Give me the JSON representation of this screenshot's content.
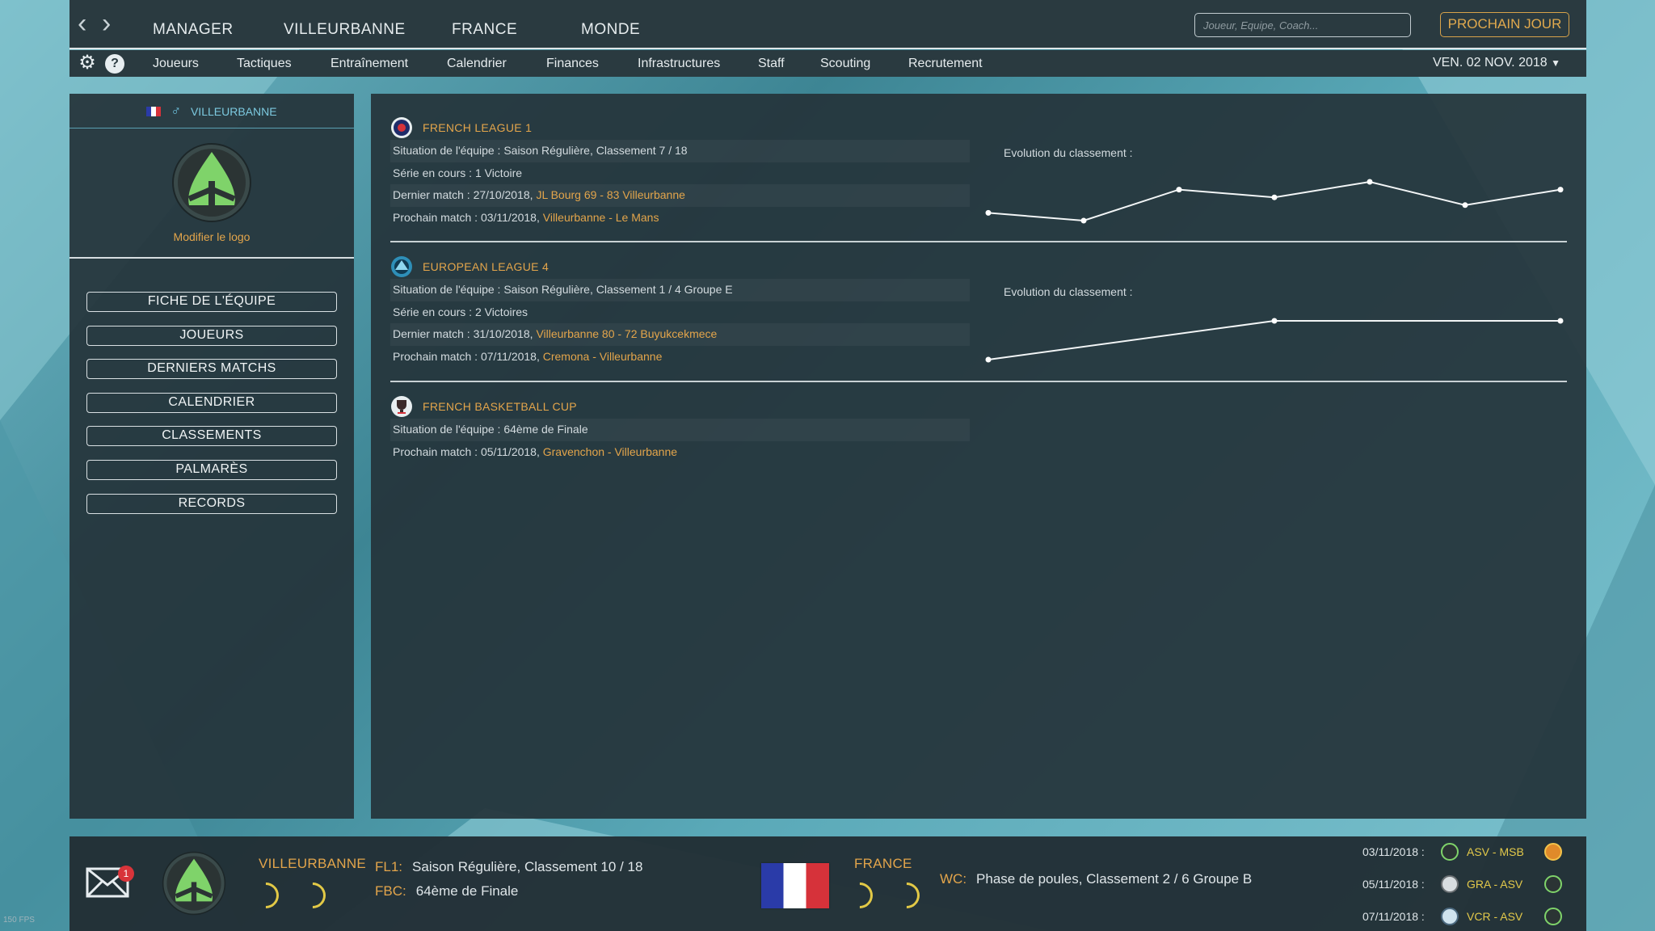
{
  "nav": {
    "main": [
      "MANAGER",
      "VILLEURBANNE",
      "FRANCE",
      "MONDE"
    ],
    "sub": [
      "Joueurs",
      "Tactiques",
      "Entraînement",
      "Calendrier",
      "Finances",
      "Infrastructures",
      "Staff",
      "Scouting",
      "Recrutement"
    ],
    "search_placeholder": "Joueur, Equipe, Coach...",
    "next_day_label": "PROCHAIN JOUR",
    "date": "VEN. 02 NOV. 2018"
  },
  "team": {
    "name": "VILLEURBANNE",
    "modify_logo": "Modifier le logo",
    "menu": [
      "FICHE DE L'ÉQUIPE",
      "JOUEURS",
      "DERNIERS MATCHS",
      "CALENDRIER",
      "CLASSEMENTS",
      "PALMARÈS",
      "RECORDS"
    ]
  },
  "competitions": [
    {
      "name": "FRENCH LEAGUE 1",
      "situation": "Situation de l'équipe : Saison Régulière, Classement 7 / 18",
      "serie": "Série en cours : 1 Victoire",
      "last_prefix": "Dernier match : 27/10/2018, ",
      "last_link": "JL Bourg 69 - 83 Villeurbanne",
      "next_prefix": "Prochain match : 03/11/2018, ",
      "next_link": "Villeurbanne - Le Mans",
      "evo_label": "Evolution du classement :",
      "evolution": [
        10,
        11,
        7,
        8,
        6,
        9,
        7
      ]
    },
    {
      "name": "EUROPEAN LEAGUE 4",
      "situation": "Situation de l'équipe : Saison Régulière, Classement 1 / 4 Groupe E",
      "serie": "Série en cours : 2 Victoires",
      "last_prefix": "Dernier match : 31/10/2018, ",
      "last_link": "Villeurbanne 80 - 72 Buyukcekmece",
      "next_prefix": "Prochain match : 07/11/2018, ",
      "next_link": "Cremona - Villeurbanne",
      "evo_label": "Evolution du classement :",
      "evolution": [
        2,
        1,
        1
      ]
    },
    {
      "name": "FRENCH BASKETBALL CUP",
      "situation": "Situation de l'équipe : 64ème de Finale",
      "next_prefix": "Prochain match : 05/11/2018, ",
      "next_link": "Gravenchon - Villeurbanne"
    }
  ],
  "bottom": {
    "mail_count": "1",
    "team_name": "VILLEURBANNE",
    "fl1_key": "FL1:",
    "fl1_value": "Saison Régulière, Classement 10 / 18",
    "fbc_key": "FBC:",
    "fbc_value": "64ème de Finale",
    "country": "FRANCE",
    "wc_key": "WC:",
    "wc_value": "Phase de poules, Classement 2 / 6 Groupe B",
    "fixtures": [
      {
        "date": "03/11/2018 :",
        "match": "ASV - MSB"
      },
      {
        "date": "05/11/2018 :",
        "match": "GRA - ASV"
      },
      {
        "date": "07/11/2018 :",
        "match": "VCR - ASV"
      }
    ]
  },
  "fps": "150 FPS",
  "colors": {
    "accent": "#e3a54b",
    "panel": "#25343a",
    "topbar": "#2a3a40",
    "link_blue": "#7cc9df"
  }
}
